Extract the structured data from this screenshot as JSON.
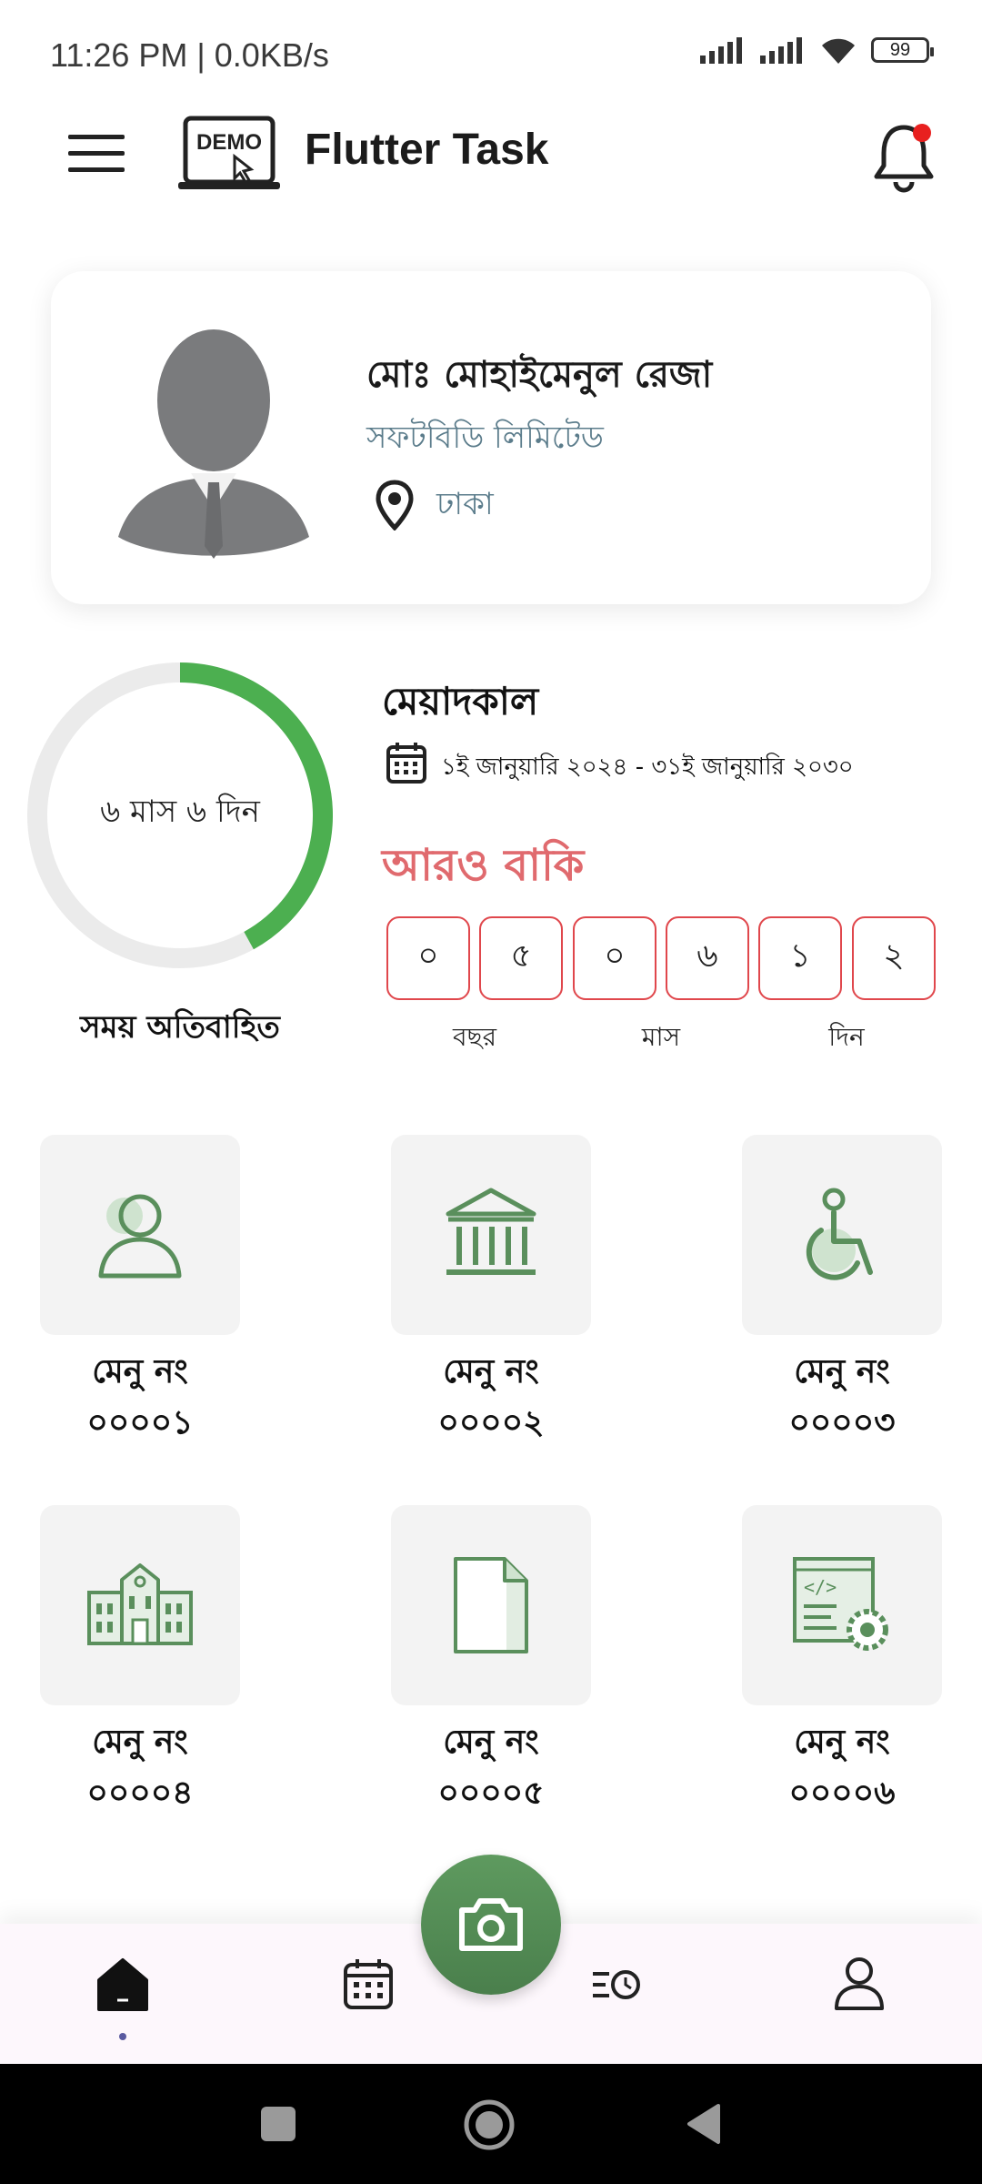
{
  "status_bar": {
    "time": "11:26 PM | 0.0KB/s",
    "battery": "99"
  },
  "app_bar": {
    "title": "Flutter Task",
    "logo_text": "DEMO"
  },
  "profile": {
    "name": "মোঃ মোহাইমেনুল রেজা",
    "company": "সফটবিডি লিমিটেড",
    "location": "ঢাকা"
  },
  "progress": {
    "elapsed_label": "৬ মাস ৬ দিন",
    "caption": "সময় অতিবাহিত",
    "elapsed_fraction": 0.42
  },
  "tenure": {
    "title": "মেয়াদকাল",
    "date_range": "১ই জানুয়ারি ২০২৪ - ৩১ই জানুয়ারি ২০৩০",
    "remaining_title": "আরও বাকি",
    "digits": [
      "০",
      "৫",
      "০",
      "৬",
      "১",
      "২"
    ],
    "units": [
      "বছর",
      "মাস",
      "দিন"
    ]
  },
  "menu": [
    {
      "line1": "মেনু নং",
      "line2": "০০০০১",
      "icon": "user-icon"
    },
    {
      "line1": "মেনু নং",
      "line2": "০০০০২",
      "icon": "bank-icon"
    },
    {
      "line1": "মেনু নং",
      "line2": "০০০০৩",
      "icon": "wheelchair-icon"
    },
    {
      "line1": "মেনু নং",
      "line2": "০০০০৪",
      "icon": "school-icon"
    },
    {
      "line1": "মেনু নং",
      "line2": "০০০০৫",
      "icon": "document-icon"
    },
    {
      "line1": "মেনু নং",
      "line2": "০০০০৬",
      "icon": "code-settings-icon"
    }
  ],
  "bottom_nav": [
    "home-icon",
    "calendar-icon",
    "camera-icon",
    "timeline-icon",
    "profile-icon"
  ],
  "colors": {
    "accent_green": "#4caf50",
    "icon_green": "#5a8f5c",
    "remaining_red": "#e06a6e",
    "digit_border": "#e0474c"
  }
}
